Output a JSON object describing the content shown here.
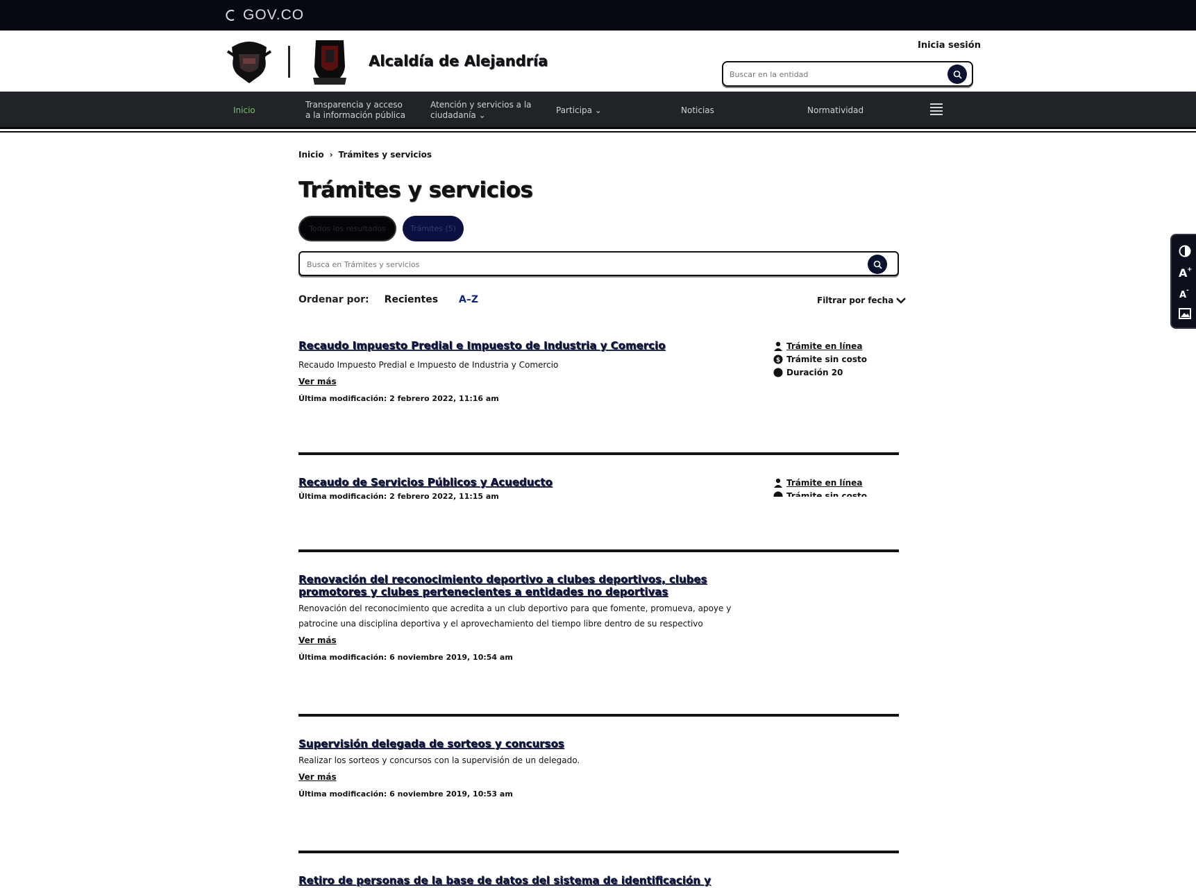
{
  "gov_logo": {
    "text": "GOV.CO"
  },
  "header": {
    "entity_name": "Alcaldía de Alejandría",
    "login_label": "Inicia sesión",
    "search_placeholder": "Buscar en la entidad"
  },
  "nav": {
    "items": [
      {
        "label": "Inicio"
      },
      {
        "label_line1": "Transparencia y acceso",
        "label_line2": "a la información pública"
      },
      {
        "label_line1": "Atención y servicios a la",
        "label_line2": "ciudadanía"
      },
      {
        "label": "Participa"
      },
      {
        "label": "Noticias"
      },
      {
        "label": "Normatividad"
      }
    ]
  },
  "breadcrumb": {
    "home": "Inicio",
    "current": "Trámites y servicios"
  },
  "page": {
    "title": "Trámites y servicios",
    "chips": {
      "all": "Todos los resultados",
      "tramites": "Trámites (5)"
    },
    "search_placeholder": "Busca en Trámites y servicios",
    "sort_label": "Ordenar por:",
    "sort_recent": "Recientes",
    "sort_az": "A–Z",
    "filter_date": "Filtrar por fecha"
  },
  "results": [
    {
      "title": "Recaudo Impuesto Predial e Impuesto de Industria y Comercio",
      "description": "Recaudo Impuesto Predial e Impuesto de Industria y Comercio",
      "more": "Ver más",
      "modified": "Última modificación: 2 febrero 2022, 11:16 am",
      "attrs": [
        "Trámite en línea",
        "Trámite sin costo",
        "Duración 20"
      ]
    },
    {
      "title": "Recaudo de Servicios Públicos y Acueducto",
      "modified": "Última modificación: 2 febrero 2022, 11:15 am",
      "attrs": [
        "Trámite en línea",
        "Trámite sin costo"
      ]
    },
    {
      "title": "Renovación del reconocimiento deportivo a clubes deportivos, clubes promotores y clubes pertenecientes a entidades no deportivas",
      "description": "Renovación del reconocimiento que acredita a un club deportivo para que fomente, promueva, apoye y patrocine una disciplina deportiva y el aprovechamiento del tiempo libre dentro de su respectivo",
      "more": "Ver más",
      "modified": "Última modificación: 6 noviembre 2019, 10:54 am"
    },
    {
      "title": "Supervisión delegada de sorteos y concursos",
      "description": "Realizar los sorteos y concursos con la supervisión de un delegado.",
      "more": "Ver más",
      "modified": "Última modificación: 6 noviembre 2019, 10:53 am"
    },
    {
      "title": "Retiro de personas de la base de datos del sistema de identificación y clasificación"
    }
  ],
  "a11y_bar": {
    "icons": [
      "contrast-icon",
      "increase-text-icon",
      "decrease-text-icon",
      "image-description-icon"
    ]
  },
  "colors": {
    "navy": "#0b1230",
    "nav_bg": "#202428",
    "gov_bar": "#05080f",
    "active_nav": "#7fbf6b"
  }
}
